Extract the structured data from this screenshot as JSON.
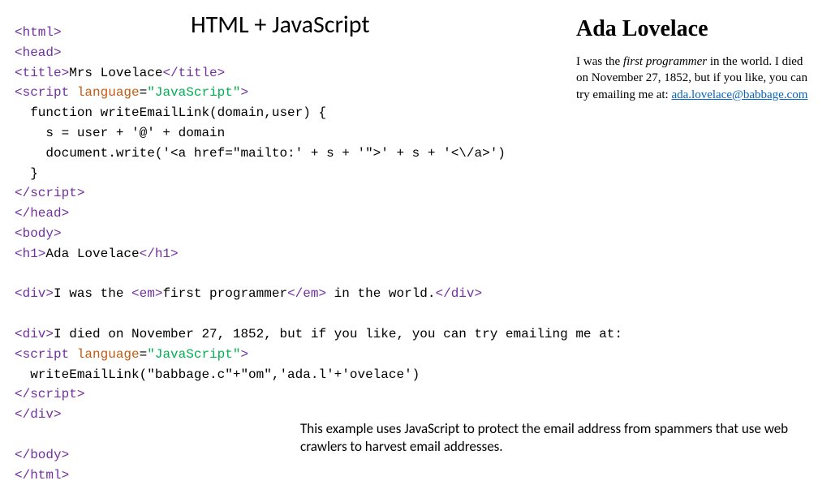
{
  "title": "HTML + JavaScript",
  "code": {
    "l1a": "<html>",
    "l2a": "<head>",
    "l3a": "<title>",
    "l3b": "Mrs Lovelace",
    "l3c": "</title>",
    "l4a": "<script",
    "l4b": " language",
    "l4c": "=",
    "l4d": "\"JavaScript\"",
    "l4e": ">",
    "l5": "  function writeEmailLink(domain,user) {",
    "l6": "    s = user + '@' + domain",
    "l7": "    document.write('<a href=\"mailto:' + s + '\">' + s + '<\\/a>')",
    "l8": "  }",
    "l9a": "</script",
    "l9b": ">",
    "l10a": "</head>",
    "l11a": "<body>",
    "l12a": "<h1>",
    "l12b": "Ada Lovelace",
    "l12c": "</h1>",
    "blank1": "",
    "l13a": "<div>",
    "l13b": "I was the ",
    "l13c": "<em>",
    "l13d": "first programmer",
    "l13e": "</em>",
    "l13f": " in the world.",
    "l13g": "</div>",
    "blank2": "",
    "l14a": "<div>",
    "l14b": "I died on November 27, 1852, but if you like, you can try emailing me at:",
    "l15a": "<script",
    "l15b": " language",
    "l15c": "=",
    "l15d": "\"JavaScript\"",
    "l15e": ">",
    "l16": "  writeEmailLink(\"babbage.c\"+\"om\",'ada.l'+'ovelace')",
    "l17a": "</script",
    "l17b": ">",
    "l18a": "</div>",
    "blank3": "",
    "l19a": "</body>",
    "l20a": "</html>"
  },
  "rendered": {
    "heading": "Ada Lovelace",
    "p1a": "I was the ",
    "p1em": "first programmer",
    "p1b": " in the world. I died on November 27, 1852, but if you like, you can try emailing me at: ",
    "email": "ada.lovelace@babbage.com"
  },
  "footnote": "This example uses JavaScript to protect the email address from spammers that use web crawlers to harvest email addresses."
}
